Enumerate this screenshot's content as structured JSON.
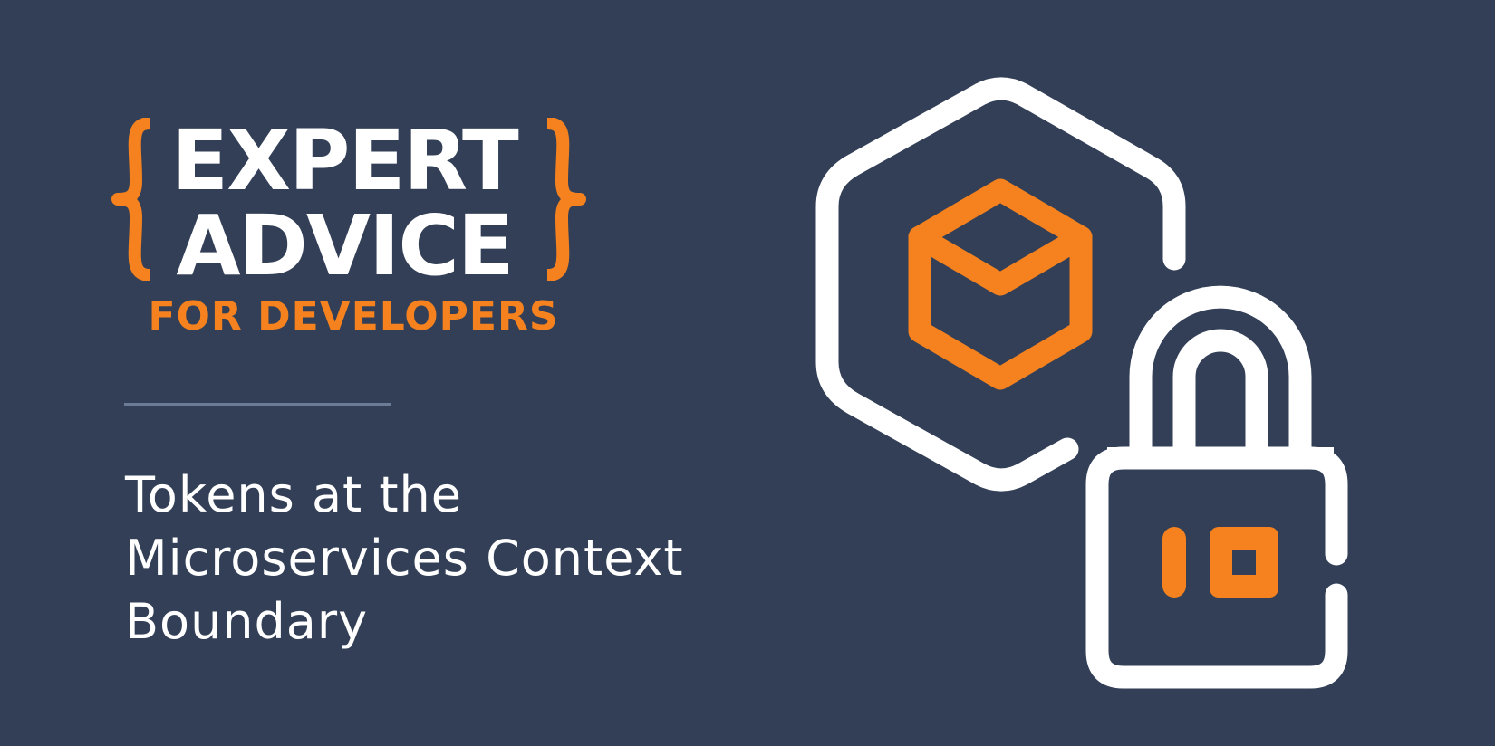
{
  "banner": {
    "title_line1": "EXPERT",
    "title_line2": "ADVICE",
    "subtitle": "FOR DEVELOPERS",
    "headline_lines": [
      "Tokens at the",
      "Microservices Context",
      "Boundary"
    ]
  },
  "colors": {
    "background": "#323f56",
    "accent": "#f5821f",
    "text": "#ffffff",
    "divider": "#6d7c96"
  },
  "icons": {
    "left_brace": "curly-brace-left-icon",
    "right_brace": "curly-brace-right-icon",
    "illustration": "hexagon-cube-padlock-icon"
  }
}
